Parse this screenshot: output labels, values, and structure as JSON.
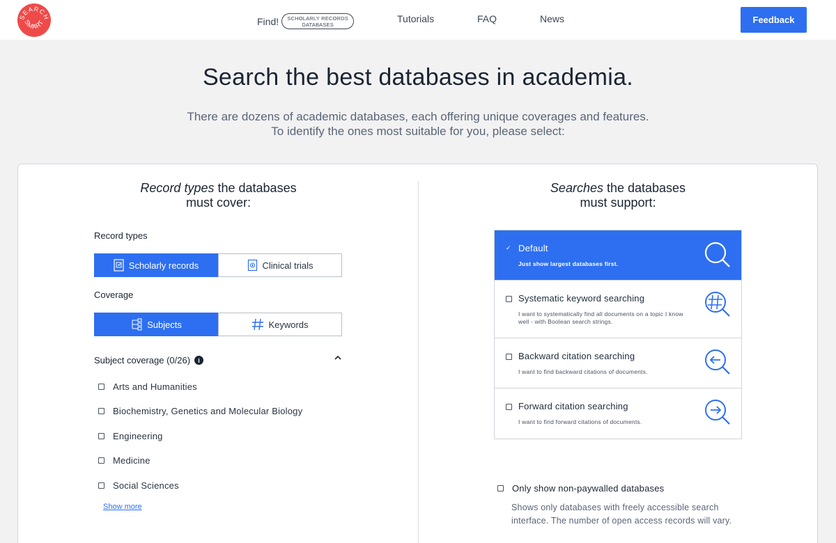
{
  "header": {
    "logo_text": "SEARCH SMART",
    "find_label": "Find!",
    "find_pill_line1": "SCHOLARLY RECORDS",
    "find_pill_line2": "DATABASES",
    "nav": [
      "Tutorials",
      "FAQ",
      "News"
    ],
    "feedback_label": "Feedback"
  },
  "hero": {
    "title": "Search the best databases in academia.",
    "subtitle_line1": "There are dozens of academic databases, each offering unique coverages and features.",
    "subtitle_line2": "To identify the ones most suitable for you, please select:"
  },
  "left": {
    "title_em": "Record types",
    "title_rest": " the databases",
    "title_line2": "must cover:",
    "record_types_label": "Record types",
    "record_types": [
      {
        "label": "Scholarly records",
        "active": true,
        "icon": "document-icon"
      },
      {
        "label": "Clinical trials",
        "active": false,
        "icon": "clinical-icon"
      }
    ],
    "coverage_label": "Coverage",
    "coverage": [
      {
        "label": "Subjects",
        "active": true,
        "icon": "tree-icon"
      },
      {
        "label": "Keywords",
        "active": false,
        "icon": "hashtag-icon"
      }
    ],
    "subject_coverage_label": "Subject coverage (0/26)",
    "subjects": [
      "Arts and Humanities",
      "Biochemistry, Genetics and Molecular Biology",
      "Engineering",
      "Medicine",
      "Social Sciences"
    ],
    "show_more": "Show more"
  },
  "right": {
    "title_em": "Searches",
    "title_rest": " the databases",
    "title_line2": "must support:",
    "options": [
      {
        "title": "Default",
        "desc": "Just show largest databases first.",
        "checked": true
      },
      {
        "title": "Systematic keyword searching",
        "desc": "I want to systematically find all documents on a topic I know well - with Boolean search strings.",
        "checked": false
      },
      {
        "title": "Backward citation searching",
        "desc": "I want to find backward citations of documents.",
        "checked": false
      },
      {
        "title": "Forward citation searching",
        "desc": "I want to find forward citations of documents.",
        "checked": false
      }
    ],
    "paywall_label": "Only show non-paywalled databases",
    "paywall_desc": "Shows only databases with freely accessible search interface. The number of open access records will vary."
  },
  "colors": {
    "accent": "#2d6ff0",
    "logo": "#ef4a4a",
    "background": "#f2f2f2"
  }
}
